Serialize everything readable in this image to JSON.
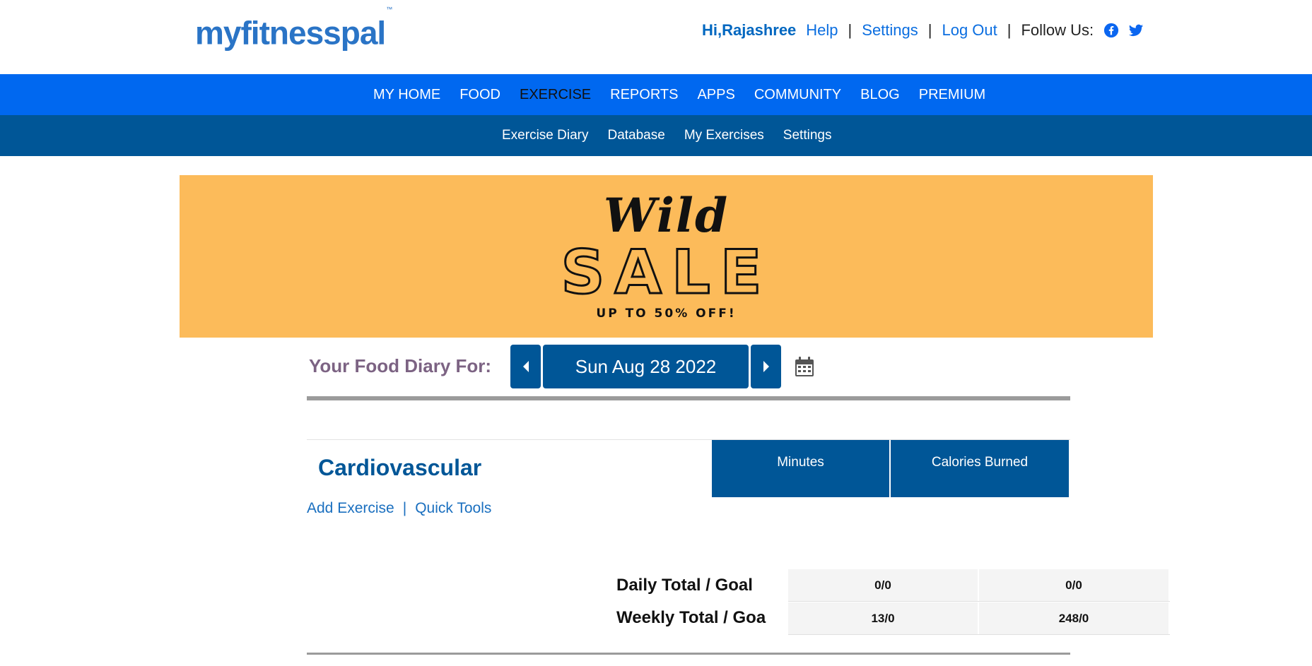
{
  "header": {
    "logo": "myfitnesspal",
    "logo_tm": "™",
    "greeting": "Hi,Rajashree",
    "help": "Help",
    "settings": "Settings",
    "logout": "Log Out",
    "follow": "Follow Us:",
    "separator": "|",
    "brand_color": "#0068f0"
  },
  "main_nav": {
    "items": [
      "MY HOME",
      "FOOD",
      "EXERCISE",
      "REPORTS",
      "APPS",
      "COMMUNITY",
      "BLOG",
      "PREMIUM"
    ],
    "active": "EXERCISE"
  },
  "sub_nav": {
    "items": [
      "Exercise Diary",
      "Database",
      "My Exercises",
      "Settings"
    ]
  },
  "banner": {
    "line1": "Wild",
    "line2": "SALE",
    "line3": "UP TO 50% OFF!"
  },
  "diary": {
    "label": "Your Food Diary For:",
    "date": "Sun Aug 28 2022"
  },
  "section": {
    "title": "Cardiovascular",
    "col_minutes": "Minutes",
    "col_calories": "Calories Burned",
    "add_exercise": "Add Exercise",
    "quick_tools": "Quick Tools",
    "separator": "|"
  },
  "totals": {
    "daily_label": "Daily Total / Goal",
    "weekly_label": "Weekly Total / Goa",
    "daily_minutes": "0/0",
    "daily_calories": "0/0",
    "weekly_minutes": "13/0",
    "weekly_calories": "248/0"
  }
}
